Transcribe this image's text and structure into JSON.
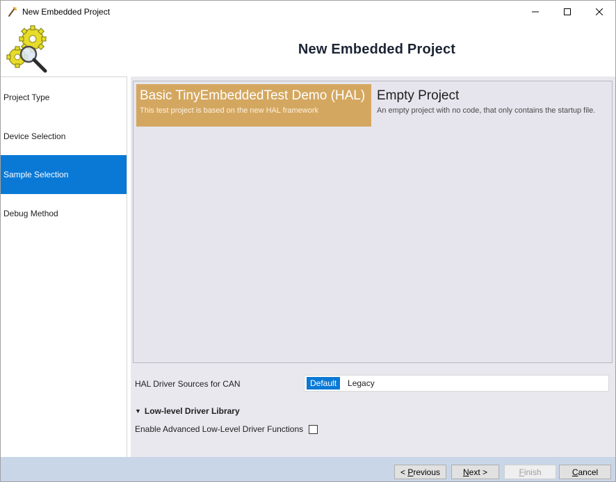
{
  "window": {
    "title": "New Embedded Project",
    "controls": {
      "minimize": "–",
      "maximize": "☐",
      "close": "✕"
    }
  },
  "header": {
    "heading": "New Embedded Project"
  },
  "sidebar": {
    "items": [
      {
        "label": "Project Type",
        "active": false
      },
      {
        "label": "Device Selection",
        "active": false
      },
      {
        "label": "Sample Selection",
        "active": true
      },
      {
        "label": "Debug Method",
        "active": false
      }
    ]
  },
  "samples": [
    {
      "title": "Basic TinyEmbeddedTest Demo (HAL)",
      "description": "This test project is based on the new HAL framework",
      "selected": true
    },
    {
      "title": "Empty Project",
      "description": "An empty project with no code, that only contains the startup file.",
      "selected": false
    }
  ],
  "hal_driver": {
    "label": "HAL Driver Sources for CAN",
    "options": [
      "Default",
      "Legacy"
    ],
    "selected": "Default"
  },
  "low_level": {
    "section_label": "Low-level Driver Library",
    "advanced_label": "Enable Advanced Low-Level Driver Functions",
    "advanced_checked": false
  },
  "footer": {
    "previous_prefix": "< ",
    "previous_key": "P",
    "previous_rest": "revious",
    "next_key": "N",
    "next_rest": "ext >",
    "finish_key": "F",
    "finish_rest": "inish",
    "cancel_key": "C",
    "cancel_rest": "ancel"
  },
  "colors": {
    "accent": "#0a79d6",
    "selected_card": "#d4a760",
    "footer_bg": "#c9d6e8",
    "content_bg": "#e9e8ef"
  }
}
